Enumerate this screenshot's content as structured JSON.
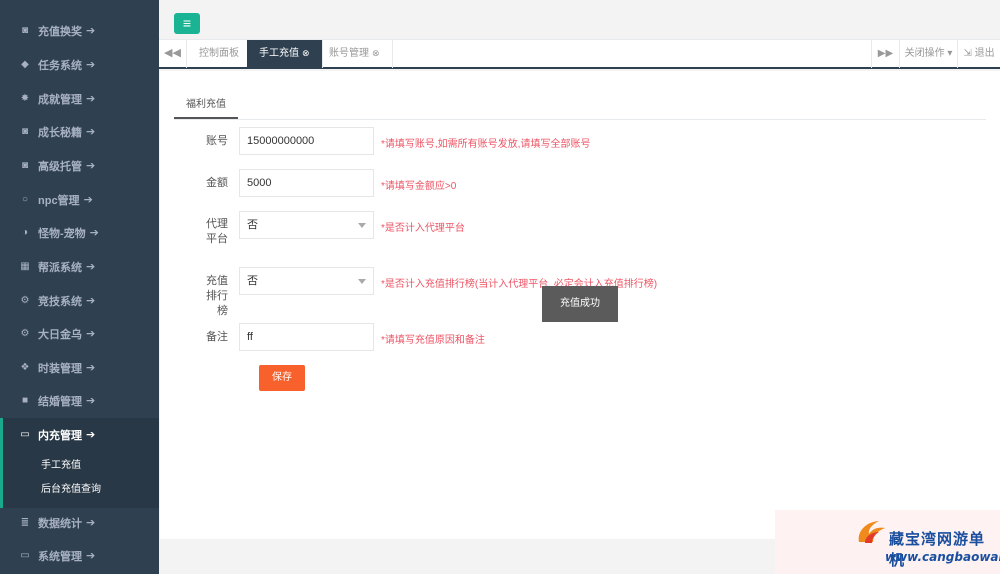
{
  "sidebar": {
    "items": [
      {
        "label": "充值换奖",
        "icon": "camera-icon"
      },
      {
        "label": "任务系统",
        "icon": "diamond-icon"
      },
      {
        "label": "成就管理",
        "icon": "star-icon"
      },
      {
        "label": "成长秘籍",
        "icon": "camera-icon"
      },
      {
        "label": "高级托管",
        "icon": "camera-icon"
      },
      {
        "label": "npc管理",
        "icon": "circle-icon"
      },
      {
        "label": "怪物-宠物",
        "icon": "half-circle-icon"
      },
      {
        "label": "帮派系统",
        "icon": "grid-icon"
      },
      {
        "label": "竞技系统",
        "icon": "cogs-icon"
      },
      {
        "label": "大日金乌",
        "icon": "cogs-icon"
      },
      {
        "label": "时装管理",
        "icon": "cubes-icon"
      },
      {
        "label": "结婚管理",
        "icon": "book-icon"
      },
      {
        "label": "内充管理",
        "icon": "desktop-icon"
      },
      {
        "label": "数据统计",
        "icon": "database-icon"
      },
      {
        "label": "系统管理",
        "icon": "desktop-icon"
      }
    ],
    "submenu": [
      "手工充值",
      "后台充值查询"
    ]
  },
  "tabs": {
    "items": [
      "控制面板",
      "手工充值",
      "账号管理"
    ],
    "close_action": "关闭操作",
    "logout": "退出"
  },
  "form": {
    "tab_label": "福利充值",
    "account": {
      "label": "账号",
      "value": "15000000000",
      "hint": "*请填写账号,如需所有账号发放,请填写全部账号"
    },
    "amount": {
      "label": "金额",
      "value": "5000",
      "hint": "*请填写金额应>0"
    },
    "agent": {
      "label": "代理平台",
      "value": "否",
      "hint": "*是否计入代理平台"
    },
    "ranking": {
      "label": "充值排行榜",
      "value": "否",
      "hint": "*是否计入充值排行榜(当计入代理平台, 必定会计入充值排行榜)"
    },
    "remark": {
      "label": "备注",
      "value": "ff",
      "hint": "*请填写充值原因和备注"
    },
    "save_label": "保存"
  },
  "toast": "充值成功",
  "watermark": {
    "title": "藏宝湾网游单机",
    "url": "www.cangbaowan.net"
  },
  "colors": {
    "sidebar": "#2f4050",
    "accent": "#1ab394",
    "save": "#f8602c",
    "hint": "#ed5565"
  }
}
